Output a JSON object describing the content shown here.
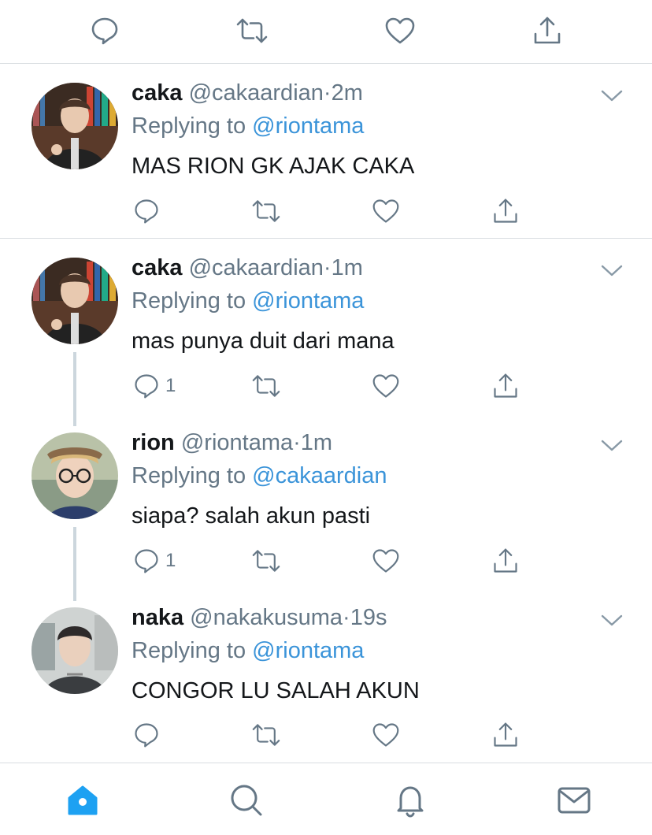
{
  "top_actions": {
    "reply_icon": "reply-icon",
    "retweet_icon": "retweet-icon",
    "like_icon": "heart-icon",
    "share_icon": "share-icon"
  },
  "tweets": [
    {
      "name": "caka",
      "handle": "@cakaardian",
      "dot": "·",
      "time": "2m",
      "reply_prefix": "Replying to ",
      "reply_to": "@riontama",
      "text": "MAS RION GK AJAK CAKA",
      "reply_count": ""
    },
    {
      "name": "caka",
      "handle": "@cakaardian",
      "dot": "·",
      "time": "1m",
      "reply_prefix": "Replying to ",
      "reply_to": "@riontama",
      "text": "mas punya duit dari mana",
      "reply_count": "1"
    },
    {
      "name": "rion",
      "handle": "@riontama",
      "dot": "·",
      "time": "1m",
      "reply_prefix": "Replying to ",
      "reply_to": "@cakaardian",
      "text": "siapa? salah akun pasti",
      "reply_count": "1"
    },
    {
      "name": "naka",
      "handle": "@nakakusuma",
      "dot": "·",
      "time": "19s",
      "reply_prefix": "Replying to ",
      "reply_to": "@riontama",
      "text": "CONGOR LU SALAH AKUN",
      "reply_count": ""
    }
  ],
  "bottom_nav": {
    "active_color": "#1da1f2",
    "inactive_color": "#657786",
    "items": [
      "home-icon",
      "search-icon",
      "notifications-icon",
      "messages-icon"
    ]
  }
}
